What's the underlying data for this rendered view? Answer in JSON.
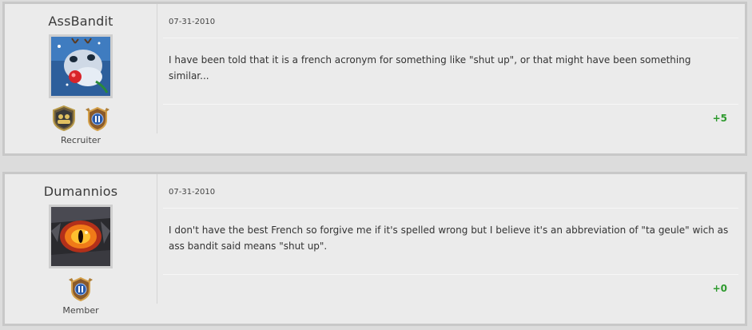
{
  "posts": [
    {
      "username": "AssBandit",
      "rank": "Recruiter",
      "date": "07-31-2010",
      "message": "I have been told that it is a french acronym for something like \"shut up\", or that might have been something similar...",
      "score": "+5",
      "avatar_icon": "reindeer-avatar-icon",
      "badges": [
        "recruiter-badge-icon",
        "member-badge-icon"
      ]
    },
    {
      "username": "Dumannios",
      "rank": "Member",
      "date": "07-31-2010",
      "message": "I don't have the best French so forgive me if it's spelled wrong but I believe it's an abbreviation of \"ta geule\" wich as ass bandit said means \"shut up\".",
      "score": "+0",
      "avatar_icon": "fiery-eye-avatar-icon",
      "badges": [
        "member-badge-icon"
      ]
    }
  ],
  "colors": {
    "post_background": "#ebebeb",
    "page_background": "#dcdcdc",
    "score_positive": "#2e9a2e"
  }
}
